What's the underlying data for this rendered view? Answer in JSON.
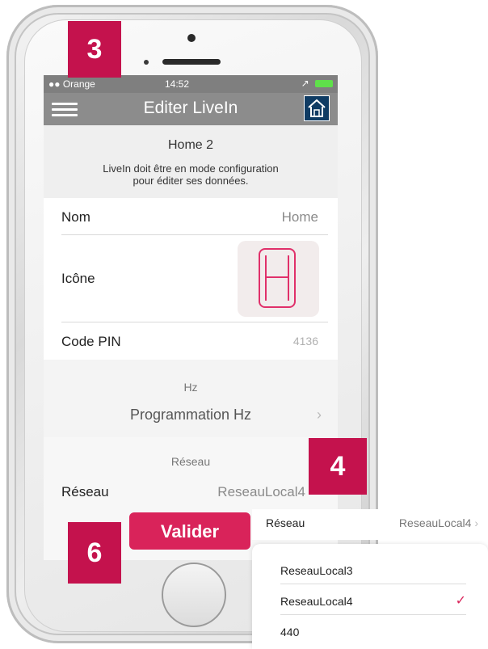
{
  "status_bar": {
    "carrier": "●● Orange",
    "time": "14:52",
    "signal": "↗"
  },
  "nav": {
    "title": "Editer LiveIn"
  },
  "header": {
    "title": "Home 2",
    "message_line1": "LiveIn doit être en mode configuration",
    "message_line2": "pour éditer ses données."
  },
  "rows": {
    "nom": {
      "label": "Nom",
      "value": "Home"
    },
    "icone": {
      "label": "Icône"
    },
    "pin": {
      "label": "Code PIN",
      "value": "4136"
    },
    "hz_section": "Hz",
    "hz_prog": "Programmation Hz",
    "reseau_section": "Réseau",
    "reseau": {
      "label": "Réseau",
      "value": "ReseauLocal4"
    }
  },
  "valider_label": "Valider",
  "badges": {
    "b3": "3",
    "b4": "4",
    "b6": "6"
  },
  "popup": {
    "row_label": "Réseau",
    "row_value": "ReseauLocal4",
    "items": [
      {
        "label": "ReseauLocal3",
        "checked": false
      },
      {
        "label": "ReseauLocal4",
        "checked": true
      },
      {
        "label": "440",
        "checked": false
      }
    ]
  },
  "icons": {
    "menu": "hamburger-icon",
    "home": "home-icon",
    "chevron": "chevron-right-icon",
    "check": "checkmark-icon"
  },
  "colors": {
    "accent": "#d9235a",
    "badge": "#c4124d",
    "navbar": "#8c8c8c"
  }
}
